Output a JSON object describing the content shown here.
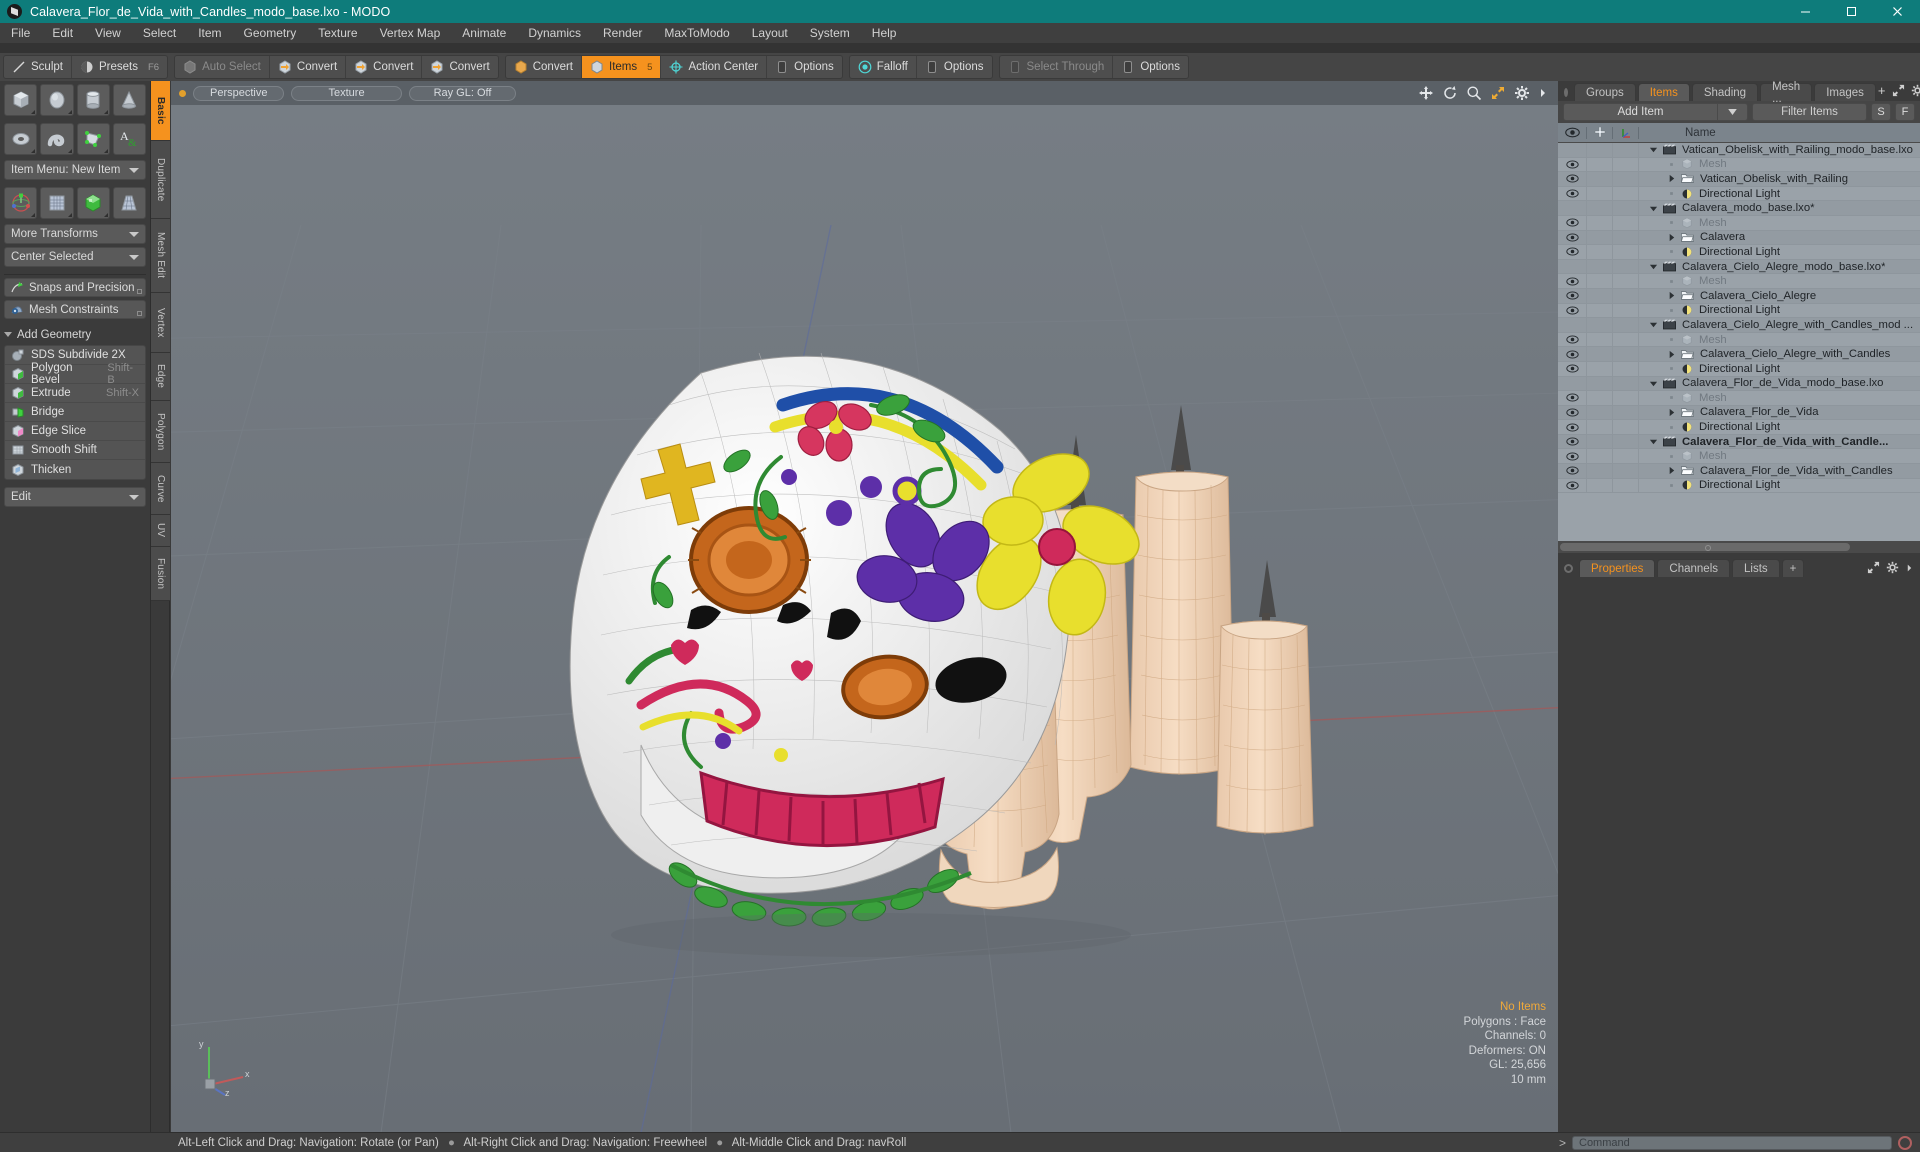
{
  "window": {
    "title": "Calavera_Flor_de_Vida_with_Candles_modo_base.lxo - MODO",
    "logo_icon": "modo-logo-icon",
    "minimize_icon": "minimize-icon",
    "maximize_icon": "maximize-icon",
    "close_icon": "close-icon"
  },
  "menubar": {
    "items": [
      {
        "label": "File"
      },
      {
        "label": "Edit"
      },
      {
        "label": "View"
      },
      {
        "label": "Select"
      },
      {
        "label": "Item"
      },
      {
        "label": "Geometry"
      },
      {
        "label": "Texture"
      },
      {
        "label": "Vertex Map"
      },
      {
        "label": "Animate"
      },
      {
        "label": "Dynamics"
      },
      {
        "label": "Render"
      },
      {
        "label": "MaxToModo"
      },
      {
        "label": "Layout"
      },
      {
        "label": "System"
      },
      {
        "label": "Help"
      }
    ]
  },
  "toolbar": {
    "groups": [
      {
        "buttons": [
          {
            "label": "Sculpt",
            "icon": "sculpt-icon",
            "state": "normal",
            "shortcut": ""
          },
          {
            "label": "Presets",
            "icon": "presets-icon",
            "state": "normal",
            "shortcut": "F6"
          }
        ]
      },
      {
        "buttons": [
          {
            "label": "Auto Select",
            "icon": "auto-select-icon",
            "state": "dim",
            "shortcut": ""
          },
          {
            "label": "Convert",
            "icon": "convert-vertex-icon",
            "state": "normal",
            "shortcut": ""
          },
          {
            "label": "Convert",
            "icon": "convert-edge-icon",
            "state": "normal",
            "shortcut": ""
          },
          {
            "label": "Convert",
            "icon": "convert-polygon-icon",
            "state": "normal",
            "shortcut": ""
          }
        ]
      },
      {
        "buttons": [
          {
            "label": "Convert",
            "icon": "convert-material-icon",
            "state": "normal",
            "shortcut": ""
          },
          {
            "label": "Items",
            "icon": "items-icon",
            "state": "active",
            "shortcut": "5"
          },
          {
            "label": "Action Center",
            "icon": "action-center-icon",
            "state": "normal",
            "shortcut": ""
          },
          {
            "label": "Options",
            "icon": "options-icon",
            "state": "normal",
            "shortcut": ""
          }
        ]
      },
      {
        "buttons": [
          {
            "label": "Falloff",
            "icon": "falloff-icon",
            "state": "normal",
            "shortcut": ""
          },
          {
            "label": "Options",
            "icon": "options-icon",
            "state": "normal",
            "shortcut": ""
          }
        ]
      },
      {
        "buttons": [
          {
            "label": "Select Through",
            "icon": "select-through-icon",
            "state": "dim",
            "shortcut": ""
          },
          {
            "label": "Options",
            "icon": "options-icon",
            "state": "normal",
            "shortcut": ""
          }
        ]
      }
    ]
  },
  "left_panel": {
    "primitive_icons": [
      "cube-icon",
      "sphere-icon",
      "cylinder-icon",
      "cone-icon"
    ],
    "primitive_icons_2": [
      "torus-icon",
      "tube-icon",
      "polygon-mesh-icon",
      "text-icon"
    ],
    "item_menu": {
      "label": "Item Menu: New Item"
    },
    "transform_icons": [
      "transform-gizmo-icon",
      "bend-icon",
      "shear-icon",
      "taper-icon"
    ],
    "more_transforms": {
      "label": "More Transforms"
    },
    "center_selected": {
      "label": "Center Selected"
    },
    "snaps": {
      "label": "Snaps and Precision",
      "icon": "snap-arrow-icon"
    },
    "mesh_constraints": {
      "label": "Mesh Constraints",
      "icon": "mesh-constraint-icon"
    },
    "add_geometry_header": {
      "label": "Add Geometry"
    },
    "geometry_tools": [
      {
        "label": "SDS Subdivide 2X",
        "shortcut": "",
        "icon": "sds-subdivide-icon"
      },
      {
        "label": "Polygon Bevel",
        "shortcut": "Shift-B",
        "icon": "polygon-bevel-icon"
      },
      {
        "label": "Extrude",
        "shortcut": "Shift-X",
        "icon": "extrude-icon"
      },
      {
        "label": "Bridge",
        "shortcut": "",
        "icon": "bridge-icon"
      },
      {
        "label": "Edge Slice",
        "shortcut": "",
        "icon": "edge-slice-icon"
      },
      {
        "label": "Smooth Shift",
        "shortcut": "",
        "icon": "smooth-shift-icon"
      },
      {
        "label": "Thicken",
        "shortcut": "",
        "icon": "thicken-icon"
      }
    ],
    "edit_menu": {
      "label": "Edit"
    },
    "vertical_tabs": [
      {
        "label": "Basic",
        "selected": true
      },
      {
        "label": "Duplicate",
        "selected": false
      },
      {
        "label": "Mesh Edit",
        "selected": false
      },
      {
        "label": "Vertex",
        "selected": false
      },
      {
        "label": "Edge",
        "selected": false
      },
      {
        "label": "Polygon",
        "selected": false
      },
      {
        "label": "Curve",
        "selected": false
      },
      {
        "label": "UV",
        "selected": false
      },
      {
        "label": "Fusion",
        "selected": false
      }
    ]
  },
  "viewport": {
    "pills": [
      {
        "label": "Perspective"
      },
      {
        "label": "Texture"
      },
      {
        "label": "Ray GL: Off"
      }
    ],
    "header_icons": [
      "move-icon",
      "rotate-icon",
      "zoom-icon",
      "fit-icon",
      "gear-icon",
      "chevron-right-icon"
    ],
    "stats": {
      "selection": "No Items",
      "polygons": "Polygons : Face",
      "channels": "Channels: 0",
      "deformers": "Deformers: ON",
      "gl": "GL: 25,656",
      "units": "10 mm"
    },
    "axis_labels": {
      "x": "x",
      "y": "y",
      "z": "z"
    }
  },
  "right_panel": {
    "tabs": [
      {
        "label": "Groups",
        "selected": false
      },
      {
        "label": "Items",
        "selected": true
      },
      {
        "label": "Shading",
        "selected": false
      },
      {
        "label": "Mesh ...",
        "selected": false
      },
      {
        "label": "Images",
        "selected": false
      }
    ],
    "tab_add": "+",
    "tab_icons": [
      "expand-icon",
      "gear-icon",
      "chevron-right-icon"
    ],
    "add_item": {
      "label": "Add Item",
      "caret_icon": "chevron-down-icon"
    },
    "filter": {
      "placeholder": "Filter Items",
      "value": ""
    },
    "filter_buttons": [
      {
        "label": "S"
      },
      {
        "label": "F"
      }
    ],
    "columns": {
      "eye_icon": "eye-icon",
      "lock_icon": "plus-lock-icon",
      "axis_icon": "axis-icon",
      "name": "Name"
    },
    "items": [
      {
        "name": "Vatican_Obelisk_with_Railing_modo_base.lxo",
        "depth": 0,
        "icon": "scene-icon",
        "expander": "down",
        "eye": false,
        "dim": false,
        "bold": false
      },
      {
        "name": "Mesh",
        "depth": 1,
        "icon": "mesh-icon",
        "expander": "dot",
        "eye": true,
        "dim": true,
        "bold": false
      },
      {
        "name": "Vatican_Obelisk_with_Railing",
        "depth": 1,
        "icon": "group-icon",
        "expander": "right",
        "eye": true,
        "dim": false,
        "bold": false
      },
      {
        "name": "Directional Light",
        "depth": 1,
        "icon": "light-icon",
        "expander": "dot",
        "eye": true,
        "dim": false,
        "bold": false
      },
      {
        "name": "Calavera_modo_base.lxo*",
        "depth": 0,
        "icon": "scene-icon",
        "expander": "down",
        "eye": false,
        "dim": false,
        "bold": false
      },
      {
        "name": "Mesh",
        "depth": 1,
        "icon": "mesh-icon",
        "expander": "dot",
        "eye": true,
        "dim": true,
        "bold": false
      },
      {
        "name": "Calavera",
        "depth": 1,
        "icon": "group-icon",
        "expander": "right",
        "eye": true,
        "dim": false,
        "bold": false
      },
      {
        "name": "Directional Light",
        "depth": 1,
        "icon": "light-icon",
        "expander": "dot",
        "eye": true,
        "dim": false,
        "bold": false
      },
      {
        "name": "Calavera_Cielo_Alegre_modo_base.lxo*",
        "depth": 0,
        "icon": "scene-icon",
        "expander": "down",
        "eye": false,
        "dim": false,
        "bold": false
      },
      {
        "name": "Mesh",
        "depth": 1,
        "icon": "mesh-icon",
        "expander": "dot",
        "eye": true,
        "dim": true,
        "bold": false
      },
      {
        "name": "Calavera_Cielo_Alegre",
        "depth": 1,
        "icon": "group-icon",
        "expander": "right",
        "eye": true,
        "dim": false,
        "bold": false
      },
      {
        "name": "Directional Light",
        "depth": 1,
        "icon": "light-icon",
        "expander": "dot",
        "eye": true,
        "dim": false,
        "bold": false
      },
      {
        "name": "Calavera_Cielo_Alegre_with_Candles_mod ...",
        "depth": 0,
        "icon": "scene-icon",
        "expander": "down",
        "eye": false,
        "dim": false,
        "bold": false
      },
      {
        "name": "Mesh",
        "depth": 1,
        "icon": "mesh-icon",
        "expander": "dot",
        "eye": true,
        "dim": true,
        "bold": false
      },
      {
        "name": "Calavera_Cielo_Alegre_with_Candles",
        "depth": 1,
        "icon": "group-icon",
        "expander": "right",
        "eye": true,
        "dim": false,
        "bold": false
      },
      {
        "name": "Directional Light",
        "depth": 1,
        "icon": "light-icon",
        "expander": "dot",
        "eye": true,
        "dim": false,
        "bold": false
      },
      {
        "name": "Calavera_Flor_de_Vida_modo_base.lxo",
        "depth": 0,
        "icon": "scene-icon",
        "expander": "down",
        "eye": false,
        "dim": false,
        "bold": false
      },
      {
        "name": "Mesh",
        "depth": 1,
        "icon": "mesh-icon",
        "expander": "dot",
        "eye": true,
        "dim": true,
        "bold": false
      },
      {
        "name": "Calavera_Flor_de_Vida",
        "depth": 1,
        "icon": "group-icon",
        "expander": "right",
        "eye": true,
        "dim": false,
        "bold": false
      },
      {
        "name": "Directional Light",
        "depth": 1,
        "icon": "light-icon",
        "expander": "dot",
        "eye": true,
        "dim": false,
        "bold": false
      },
      {
        "name": "Calavera_Flor_de_Vida_with_Candle...",
        "depth": 0,
        "icon": "scene-icon",
        "expander": "down",
        "eye": true,
        "dim": false,
        "bold": true
      },
      {
        "name": "Mesh",
        "depth": 1,
        "icon": "mesh-icon",
        "expander": "dot",
        "eye": true,
        "dim": true,
        "bold": false
      },
      {
        "name": "Calavera_Flor_de_Vida_with_Candles",
        "depth": 1,
        "icon": "group-icon",
        "expander": "right",
        "eye": true,
        "dim": false,
        "bold": false
      },
      {
        "name": "Directional Light",
        "depth": 1,
        "icon": "light-icon",
        "expander": "dot",
        "eye": true,
        "dim": false,
        "bold": false
      }
    ],
    "bottom_tabs": [
      {
        "label": "Properties",
        "selected": true
      },
      {
        "label": "Channels",
        "selected": false
      },
      {
        "label": "Lists",
        "selected": false
      }
    ],
    "bottom_tab_add": "+",
    "bottom_tab_icons": [
      "expand-icon",
      "gear-icon",
      "chevron-right-icon"
    ]
  },
  "statusbar": {
    "hints": [
      "Alt-Left Click and Drag: Navigation: Rotate (or Pan)",
      "Alt-Right Click and Drag: Navigation: Freewheel",
      "Alt-Middle Click and Drag: navRoll"
    ],
    "prompt": ">",
    "command_placeholder": "Command",
    "record_icon": "record-icon"
  },
  "colors": {
    "title_bg": "#0e7c7b",
    "accent": "#f5921e",
    "panel_bg": "#3b3b3b",
    "viewport_bg": "#6e747a",
    "list_bg": "#9aa2a9"
  }
}
